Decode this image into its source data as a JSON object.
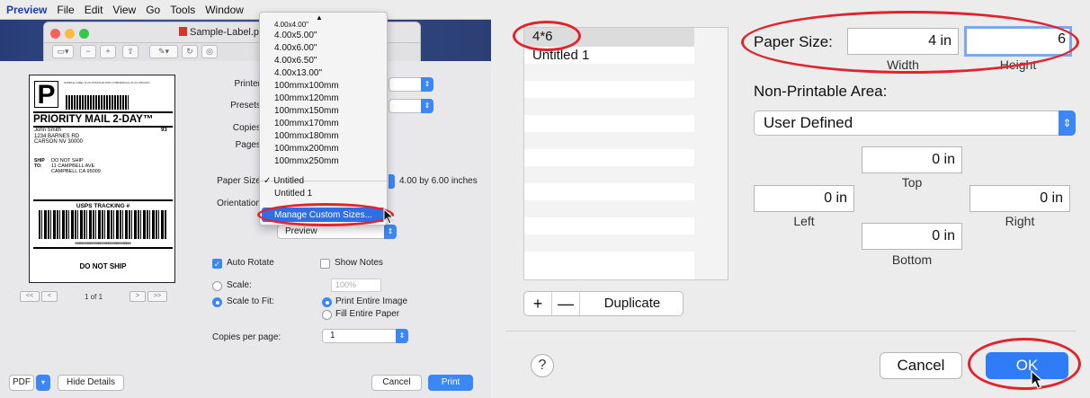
{
  "left_panel": {
    "menubar": [
      "Preview",
      "File",
      "Edit",
      "View",
      "Go",
      "Tools",
      "Window"
    ],
    "window_title": "Sample-Label.pdf (",
    "label": {
      "big_letter": "P",
      "sample_text": "SAMPLE LABEL  $ US POSTAGE PAID  COMMERCIAL PLUS PRICING",
      "service": "PRIORITY MAIL 2-DAY™",
      "from": [
        "John Smith",
        "1234 BARNES RD",
        "CARSON NV 30000"
      ],
      "zone": "93",
      "ship_to_label": "SHIP\nTO:",
      "to": [
        "DO NOT SHIP",
        "11 CAMPBELL AVE",
        "CAMPBELL CA 95009"
      ],
      "tracking_heading": "USPS TRACKING #",
      "tracking_number": "9999999999999999999999999999",
      "footer": "DO NOT SHIP"
    },
    "pager": {
      "prev_first": "<<",
      "prev": "<",
      "text": "1 of 1",
      "next": ">",
      "next_last": ">>"
    },
    "form": {
      "printer_label": "Printer",
      "presets_label": "Presets",
      "copies_label": "Copies",
      "pages_label": "Pages",
      "paper_size_label": "Paper Size",
      "paper_size_value": "4.00 by 6.00 inches",
      "orientation_label": "Orientation",
      "section_popup": "Preview",
      "auto_rotate": "Auto Rotate",
      "show_notes": "Show Notes",
      "scale": "Scale:",
      "scale_value": "100%",
      "scale_to_fit": "Scale to Fit:",
      "print_entire_image": "Print Entire Image",
      "fill_entire_paper": "Fill Entire Paper",
      "copies_per_page_label": "Copies per page:",
      "copies_per_page_value": "1"
    },
    "bottom": {
      "pdf": "PDF",
      "hide_details": "Hide Details",
      "cancel": "Cancel",
      "print": "Print"
    },
    "menu": {
      "up_arrow": "▲",
      "items": [
        "4.00x4.00\"",
        "4.00x5.00\"",
        "4.00x6.00\"",
        "4.00x6.50\"",
        "4.00x13.00\"",
        "100mmx100mm",
        "100mmx120mm",
        "100mmx150mm",
        "100mmx170mm",
        "100mmx180mm",
        "100mmx200mm",
        "100mmx250mm"
      ],
      "custom_checked": "✓ Untitled",
      "custom_2": "Untitled 1",
      "manage": "Manage Custom Sizes..."
    }
  },
  "right_panel": {
    "list": [
      "4*6",
      "Untitled 1"
    ],
    "list_buttons": {
      "add": "+",
      "remove": "—",
      "duplicate": "Duplicate"
    },
    "paper_size_label": "Paper Size:",
    "width_value": "4 in",
    "height_value": "6",
    "width_label": "Width",
    "height_label": "Height",
    "non_printable_label": "Non-Printable Area:",
    "non_printable_value": "User Defined",
    "top_value": "0 in",
    "top_label": "Top",
    "left_value": "0 in",
    "left_label": "Left",
    "right_value": "0 in",
    "right_label": "Right",
    "bottom_value": "0 in",
    "bottom_label": "Bottom",
    "help": "?",
    "cancel": "Cancel",
    "ok": "OK"
  },
  "colors": {
    "accent_blue": "#3d86f5",
    "highlight_red": "#e3232b"
  }
}
